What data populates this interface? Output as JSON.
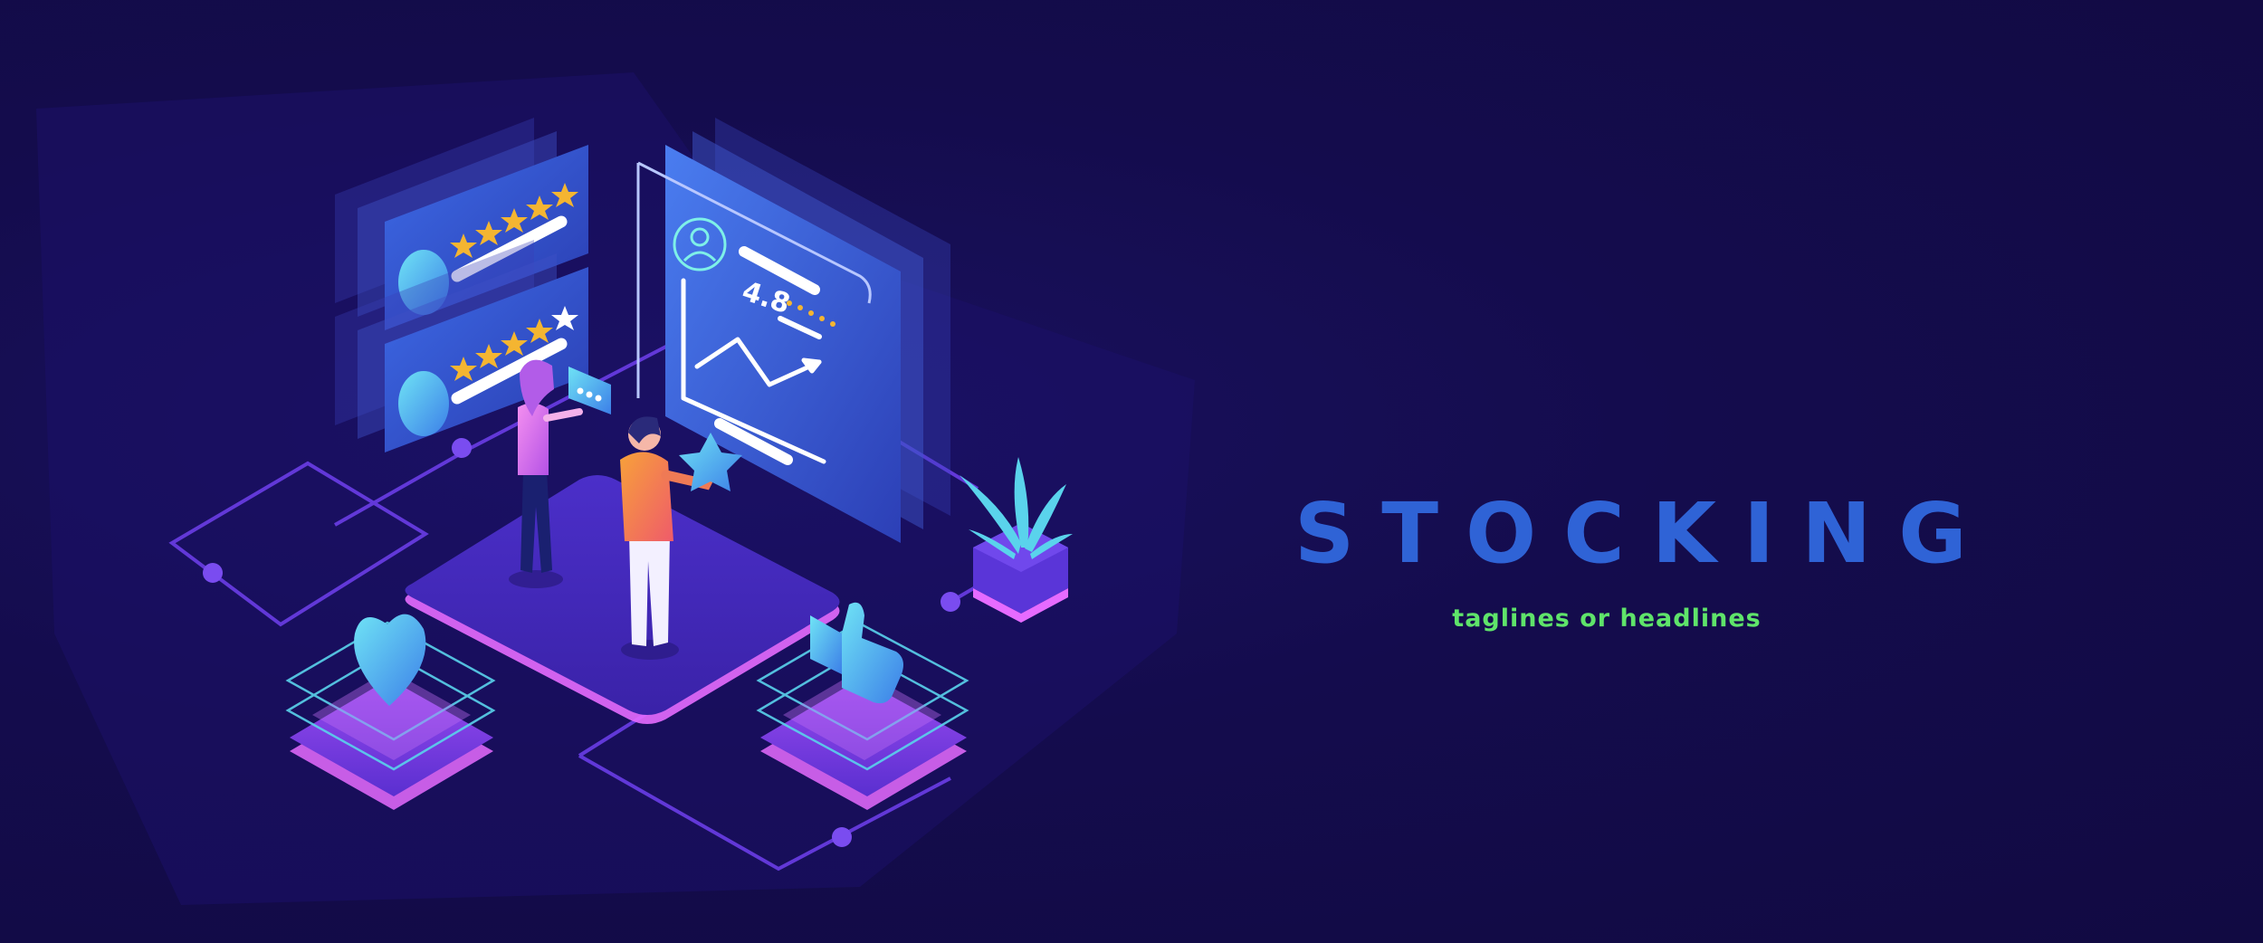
{
  "banner": {
    "headline": "STOCKING",
    "tagline": "taglines or headlines"
  },
  "dashboard_panel": {
    "rating": "4.8"
  },
  "colors": {
    "background": "#130c4a",
    "headline": "#2f63d6",
    "tagline": "#5fe46a",
    "star": "#f4b531",
    "platform_purple": "#5b35d8",
    "glow_pink": "#e66bff",
    "accent_cyan": "#5ad3ec"
  },
  "icons": [
    "star-icon",
    "user-avatar-icon",
    "line-chart-icon",
    "heart-icon",
    "thumbs-up-icon",
    "chat-bubble-icon",
    "plant-icon"
  ]
}
